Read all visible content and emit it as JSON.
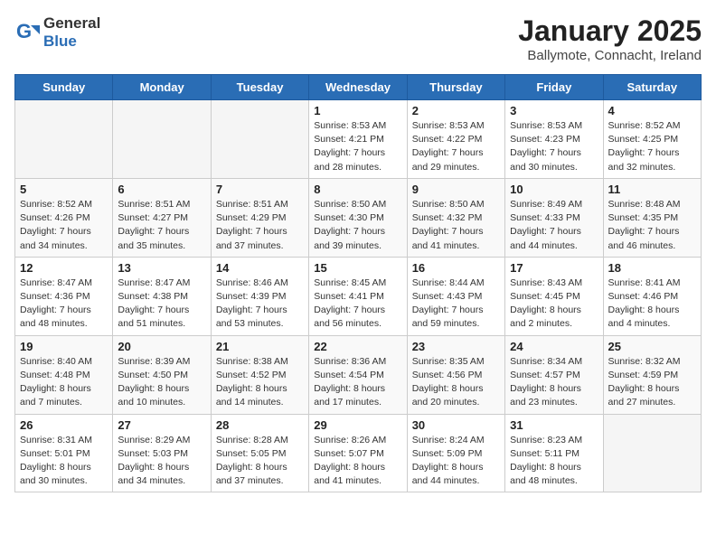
{
  "logo": {
    "text_general": "General",
    "text_blue": "Blue"
  },
  "header": {
    "title": "January 2025",
    "subtitle": "Ballymote, Connacht, Ireland"
  },
  "weekdays": [
    "Sunday",
    "Monday",
    "Tuesday",
    "Wednesday",
    "Thursday",
    "Friday",
    "Saturday"
  ],
  "weeks": [
    [
      {
        "day": "",
        "info": ""
      },
      {
        "day": "",
        "info": ""
      },
      {
        "day": "",
        "info": ""
      },
      {
        "day": "1",
        "info": "Sunrise: 8:53 AM\nSunset: 4:21 PM\nDaylight: 7 hours\nand 28 minutes."
      },
      {
        "day": "2",
        "info": "Sunrise: 8:53 AM\nSunset: 4:22 PM\nDaylight: 7 hours\nand 29 minutes."
      },
      {
        "day": "3",
        "info": "Sunrise: 8:53 AM\nSunset: 4:23 PM\nDaylight: 7 hours\nand 30 minutes."
      },
      {
        "day": "4",
        "info": "Sunrise: 8:52 AM\nSunset: 4:25 PM\nDaylight: 7 hours\nand 32 minutes."
      }
    ],
    [
      {
        "day": "5",
        "info": "Sunrise: 8:52 AM\nSunset: 4:26 PM\nDaylight: 7 hours\nand 34 minutes."
      },
      {
        "day": "6",
        "info": "Sunrise: 8:51 AM\nSunset: 4:27 PM\nDaylight: 7 hours\nand 35 minutes."
      },
      {
        "day": "7",
        "info": "Sunrise: 8:51 AM\nSunset: 4:29 PM\nDaylight: 7 hours\nand 37 minutes."
      },
      {
        "day": "8",
        "info": "Sunrise: 8:50 AM\nSunset: 4:30 PM\nDaylight: 7 hours\nand 39 minutes."
      },
      {
        "day": "9",
        "info": "Sunrise: 8:50 AM\nSunset: 4:32 PM\nDaylight: 7 hours\nand 41 minutes."
      },
      {
        "day": "10",
        "info": "Sunrise: 8:49 AM\nSunset: 4:33 PM\nDaylight: 7 hours\nand 44 minutes."
      },
      {
        "day": "11",
        "info": "Sunrise: 8:48 AM\nSunset: 4:35 PM\nDaylight: 7 hours\nand 46 minutes."
      }
    ],
    [
      {
        "day": "12",
        "info": "Sunrise: 8:47 AM\nSunset: 4:36 PM\nDaylight: 7 hours\nand 48 minutes."
      },
      {
        "day": "13",
        "info": "Sunrise: 8:47 AM\nSunset: 4:38 PM\nDaylight: 7 hours\nand 51 minutes."
      },
      {
        "day": "14",
        "info": "Sunrise: 8:46 AM\nSunset: 4:39 PM\nDaylight: 7 hours\nand 53 minutes."
      },
      {
        "day": "15",
        "info": "Sunrise: 8:45 AM\nSunset: 4:41 PM\nDaylight: 7 hours\nand 56 minutes."
      },
      {
        "day": "16",
        "info": "Sunrise: 8:44 AM\nSunset: 4:43 PM\nDaylight: 7 hours\nand 59 minutes."
      },
      {
        "day": "17",
        "info": "Sunrise: 8:43 AM\nSunset: 4:45 PM\nDaylight: 8 hours\nand 2 minutes."
      },
      {
        "day": "18",
        "info": "Sunrise: 8:41 AM\nSunset: 4:46 PM\nDaylight: 8 hours\nand 4 minutes."
      }
    ],
    [
      {
        "day": "19",
        "info": "Sunrise: 8:40 AM\nSunset: 4:48 PM\nDaylight: 8 hours\nand 7 minutes."
      },
      {
        "day": "20",
        "info": "Sunrise: 8:39 AM\nSunset: 4:50 PM\nDaylight: 8 hours\nand 10 minutes."
      },
      {
        "day": "21",
        "info": "Sunrise: 8:38 AM\nSunset: 4:52 PM\nDaylight: 8 hours\nand 14 minutes."
      },
      {
        "day": "22",
        "info": "Sunrise: 8:36 AM\nSunset: 4:54 PM\nDaylight: 8 hours\nand 17 minutes."
      },
      {
        "day": "23",
        "info": "Sunrise: 8:35 AM\nSunset: 4:56 PM\nDaylight: 8 hours\nand 20 minutes."
      },
      {
        "day": "24",
        "info": "Sunrise: 8:34 AM\nSunset: 4:57 PM\nDaylight: 8 hours\nand 23 minutes."
      },
      {
        "day": "25",
        "info": "Sunrise: 8:32 AM\nSunset: 4:59 PM\nDaylight: 8 hours\nand 27 minutes."
      }
    ],
    [
      {
        "day": "26",
        "info": "Sunrise: 8:31 AM\nSunset: 5:01 PM\nDaylight: 8 hours\nand 30 minutes."
      },
      {
        "day": "27",
        "info": "Sunrise: 8:29 AM\nSunset: 5:03 PM\nDaylight: 8 hours\nand 34 minutes."
      },
      {
        "day": "28",
        "info": "Sunrise: 8:28 AM\nSunset: 5:05 PM\nDaylight: 8 hours\nand 37 minutes."
      },
      {
        "day": "29",
        "info": "Sunrise: 8:26 AM\nSunset: 5:07 PM\nDaylight: 8 hours\nand 41 minutes."
      },
      {
        "day": "30",
        "info": "Sunrise: 8:24 AM\nSunset: 5:09 PM\nDaylight: 8 hours\nand 44 minutes."
      },
      {
        "day": "31",
        "info": "Sunrise: 8:23 AM\nSunset: 5:11 PM\nDaylight: 8 hours\nand 48 minutes."
      },
      {
        "day": "",
        "info": ""
      }
    ]
  ]
}
